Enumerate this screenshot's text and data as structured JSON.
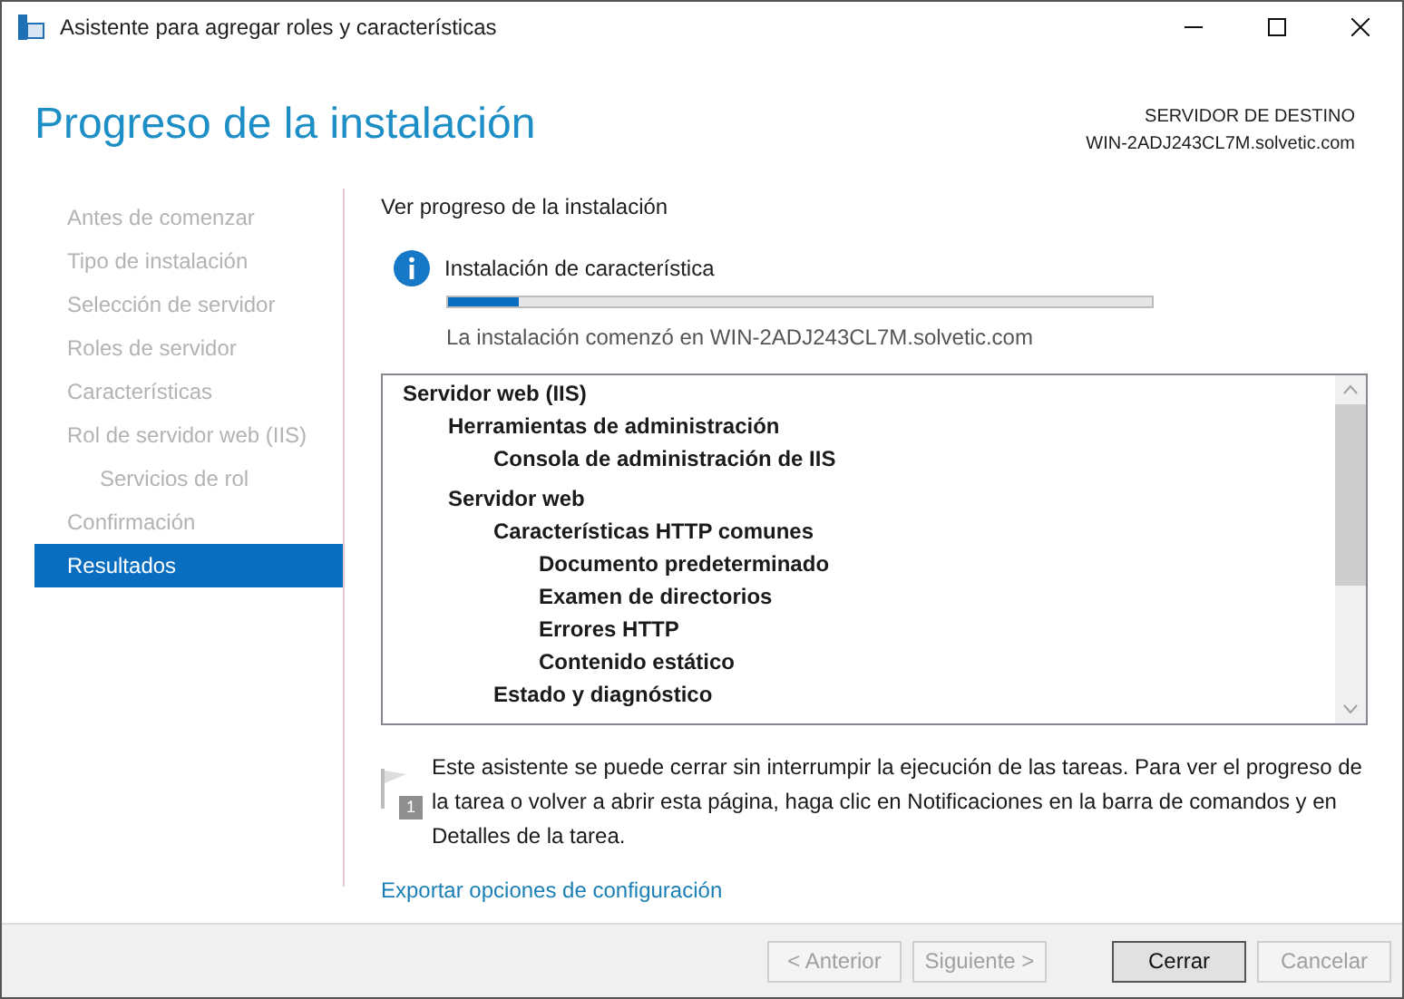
{
  "window": {
    "title": "Asistente para agregar roles y características"
  },
  "header": {
    "title": "Progreso de la instalación",
    "server_label": "SERVIDOR DE DESTINO",
    "server_name": "WIN-2ADJ243CL7M.solvetic.com"
  },
  "sidebar": {
    "items": [
      {
        "label": "Antes de comenzar",
        "selected": false
      },
      {
        "label": "Tipo de instalación",
        "selected": false
      },
      {
        "label": "Selección de servidor",
        "selected": false
      },
      {
        "label": "Roles de servidor",
        "selected": false
      },
      {
        "label": "Características",
        "selected": false
      },
      {
        "label": "Rol de servidor web (IIS)",
        "selected": false,
        "children": [
          {
            "label": "Servicios de rol",
            "selected": false
          }
        ]
      },
      {
        "label": "Confirmación",
        "selected": false
      },
      {
        "label": "Resultados",
        "selected": true
      }
    ]
  },
  "content": {
    "heading": "Ver progreso de la instalación",
    "status": "Instalación de característica",
    "progress": {
      "level": 0.1
    },
    "started": "La instalación comenzó en WIN-2ADJ243CL7M.solvetic.com",
    "tree": [
      {
        "label": "Servidor web (IIS)",
        "children": [
          {
            "label": "Herramientas de administración",
            "children": [
              {
                "label": "Consola de administración de IIS"
              }
            ]
          },
          {
            "label": "Servidor web",
            "children": [
              {
                "label": "Características HTTP comunes",
                "children": [
                  {
                    "label": "Documento predeterminado"
                  },
                  {
                    "label": "Examen de directorios"
                  },
                  {
                    "label": "Errores HTTP"
                  },
                  {
                    "label": "Contenido estático"
                  }
                ]
              },
              {
                "label": "Estado y diagnóstico"
              }
            ]
          }
        ]
      }
    ],
    "notice_badge": "1",
    "notice": "Este asistente se puede cerrar sin interrumpir la ejecución de las tareas. Para ver el progreso de la tarea o volver a abrir esta página, haga clic en Notificaciones en la barra de comandos y en Detalles de la tarea.",
    "export_link": "Exportar opciones de configuración"
  },
  "buttons": [
    {
      "label": "< Anterior",
      "disabled": true,
      "default": false
    },
    {
      "label": "Siguiente >",
      "disabled": true,
      "default": false
    },
    {
      "label": "Cerrar",
      "disabled": false,
      "default": true
    },
    {
      "label": "Cancelar",
      "disabled": true,
      "default": false
    }
  ]
}
